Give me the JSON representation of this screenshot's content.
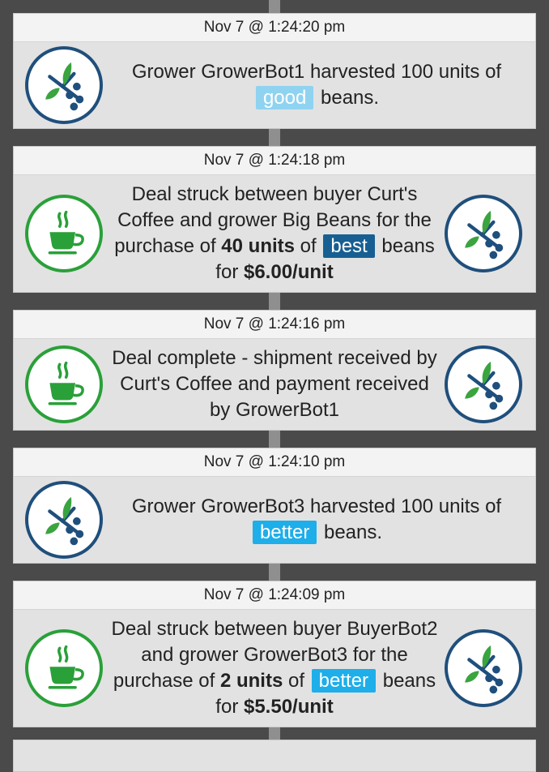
{
  "events": [
    {
      "timestamp": "Nov 7 @ 1:24:20 pm",
      "left_icon": "coffee-plant-icon",
      "text_a": "Grower GrowerBot1 harvested 100 units of",
      "quality": "good",
      "text_b": "beans."
    },
    {
      "timestamp": "Nov 7 @ 1:24:18 pm",
      "left_icon": "coffee-cup-icon",
      "right_icon": "coffee-plant-icon",
      "text_a": "Deal struck between buyer Curt's Coffee and grower Big Beans for the purchase of",
      "units": "40 units",
      "text_b": "of",
      "quality": "best",
      "text_c": "beans for",
      "price": "$6.00/unit"
    },
    {
      "timestamp": "Nov 7 @ 1:24:16 pm",
      "left_icon": "coffee-cup-icon",
      "right_icon": "coffee-plant-icon",
      "text_a": "Deal complete - shipment received by Curt's Coffee and payment received by GrowerBot1"
    },
    {
      "timestamp": "Nov 7 @ 1:24:10 pm",
      "left_icon": "coffee-plant-icon",
      "text_a": "Grower GrowerBot3 harvested 100 units of",
      "quality": "better",
      "text_b": "beans."
    },
    {
      "timestamp": "Nov 7 @ 1:24:09 pm",
      "left_icon": "coffee-cup-icon",
      "right_icon": "coffee-plant-icon",
      "text_a": "Deal struck between buyer BuyerBot2 and grower GrowerBot3 for the purchase of",
      "units": "2 units",
      "text_b": "of",
      "quality": "better",
      "text_c": "beans for",
      "price": "$5.50/unit"
    }
  ],
  "colors": {
    "background": "#4a4a4a",
    "timeline": "#8f8f8f",
    "grower_ring": "#1f4f7c",
    "buyer_ring": "#2aa039",
    "good": "#8fd3f1",
    "better": "#1eaeea",
    "best": "#175f92"
  }
}
